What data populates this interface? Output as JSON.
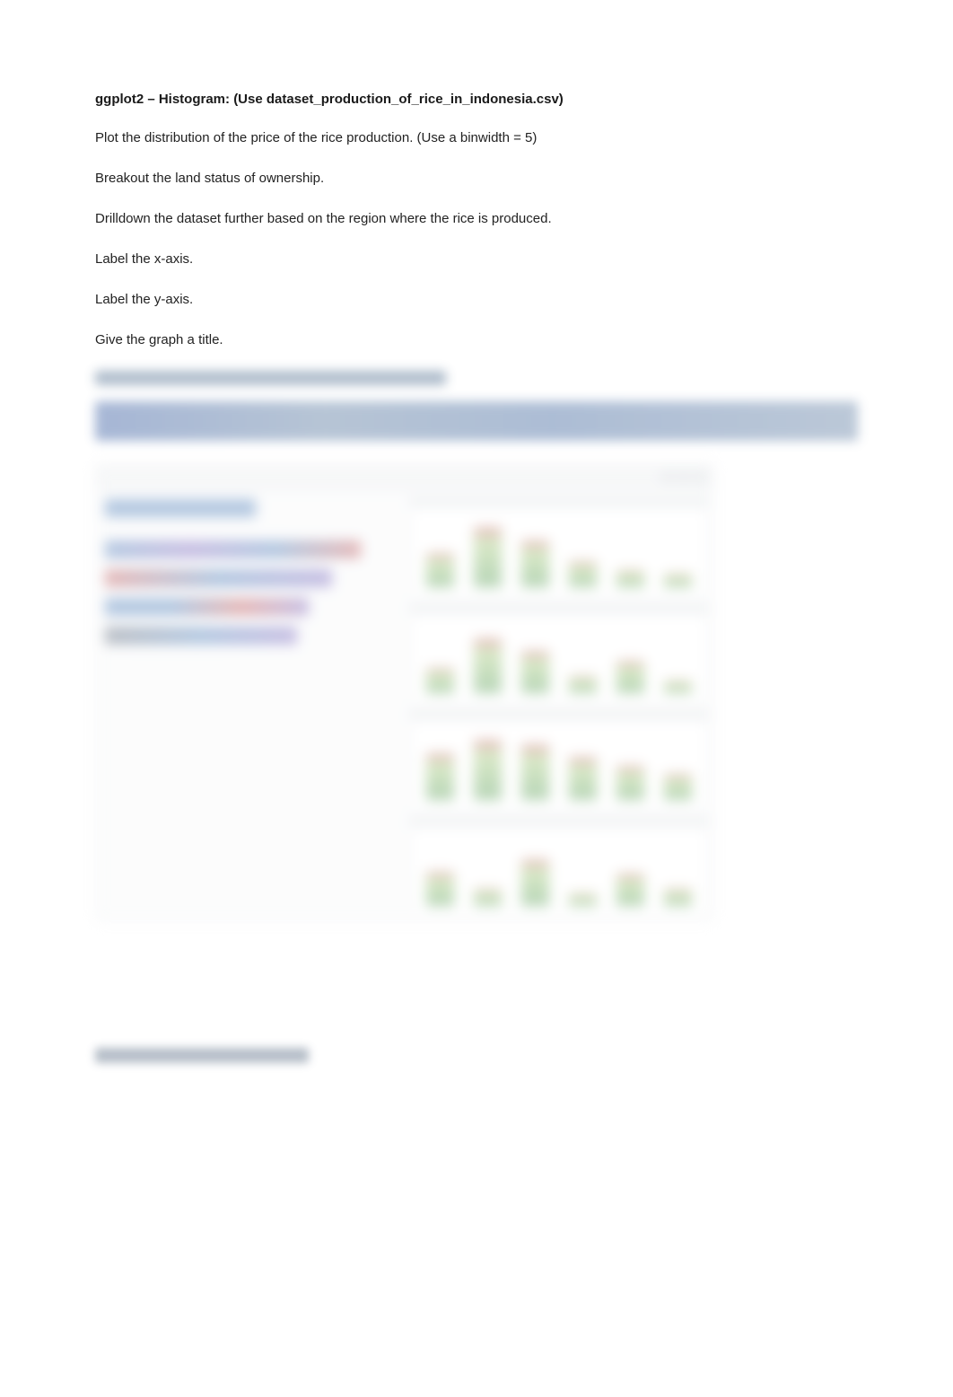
{
  "heading_prefix": "ggplot2 – Histogram: ",
  "heading_suffix": "(Use dataset_production_of_rice_in_indonesia.csv)",
  "instructions": [
    "Plot the distribution of the price of the rice production. (Use a binwidth = 5)",
    "Breakout the land status of ownership.",
    "Drilldown the dataset further based on the region where the rice is produced.",
    "Label the x-axis.",
    "Label the y-axis.",
    "Give the graph a title."
  ]
}
